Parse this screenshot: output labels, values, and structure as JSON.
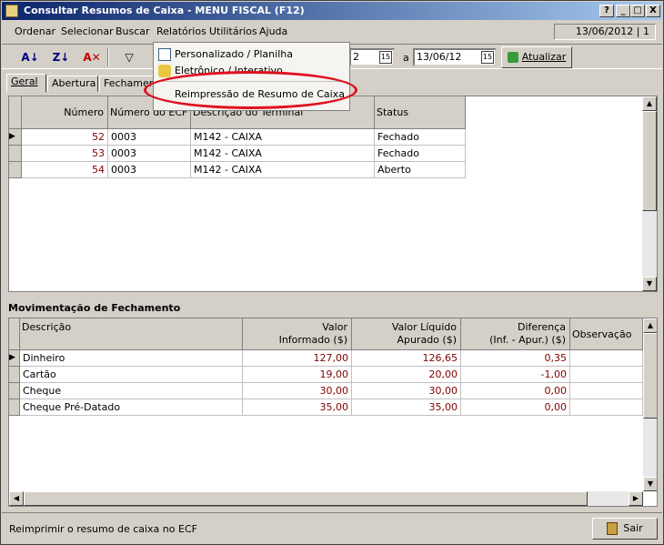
{
  "window": {
    "title": "Consultar Resumos de Caixa - MENU FISCAL (F12)",
    "buttons": [
      "?",
      "_",
      "□",
      "X"
    ]
  },
  "menu": {
    "items": [
      "Ordenar",
      "Selecionar",
      "Buscar",
      "Relatórios",
      "Utilitários",
      "Ajuda"
    ],
    "date_info": "13/06/2012 | 1"
  },
  "toolbar": {
    "icons": [
      "sort-az-icon",
      "sort-za-icon",
      "clear-filter-icon",
      "filter-icon"
    ],
    "date_from": "2",
    "date_sep": "a",
    "date_to": "13/06/12",
    "cal_label": "15",
    "refresh_label": "Atualizar"
  },
  "dropdown": {
    "items": [
      {
        "label": "Personalizado / Planilha",
        "icon": "spreadsheet-icon"
      },
      {
        "label": "Eletrônico / Interativo",
        "icon": "interactive-icon"
      },
      {
        "label": "Reimpressão de Resumo de Caixa"
      }
    ]
  },
  "tabs": [
    "Geral",
    "Abertura",
    "Fechamento"
  ],
  "top_grid": {
    "columns": [
      "Número",
      "Número do ECF",
      "Descrição do Terminal",
      "Status"
    ],
    "rows": [
      [
        "52",
        "0003",
        "M142 - CAIXA",
        "Fechado"
      ],
      [
        "53",
        "0003",
        "M142 - CAIXA",
        "Fechado"
      ],
      [
        "54",
        "0003",
        "M142 - CAIXA",
        "Aberto"
      ]
    ]
  },
  "section2": {
    "title": "Movimentação de Fechamento"
  },
  "bottom_grid": {
    "columns": [
      [
        "Descrição",
        ""
      ],
      [
        "Valor",
        "Informado ($)"
      ],
      [
        "Valor Líquido",
        "Apurado ($)"
      ],
      [
        "Diferença",
        "(Inf. - Apur.) ($)"
      ],
      [
        "Observação",
        ""
      ]
    ],
    "rows": [
      [
        "Dinheiro",
        "127,00",
        "126,65",
        "0,35",
        ""
      ],
      [
        "Cartão",
        "19,00",
        "20,00",
        "-1,00",
        ""
      ],
      [
        "Cheque",
        "30,00",
        "30,00",
        "0,00",
        ""
      ],
      [
        "Cheque Pré-Datado",
        "35,00",
        "35,00",
        "0,00",
        ""
      ]
    ]
  },
  "status": {
    "text": "Reimprimir o resumo de caixa no ECF",
    "exit_label": "Sair"
  },
  "colors": {
    "title_start": "#0a246a",
    "title_end": "#a6caf0",
    "red_values": "#800000",
    "highlight_oval": "#e01020"
  }
}
